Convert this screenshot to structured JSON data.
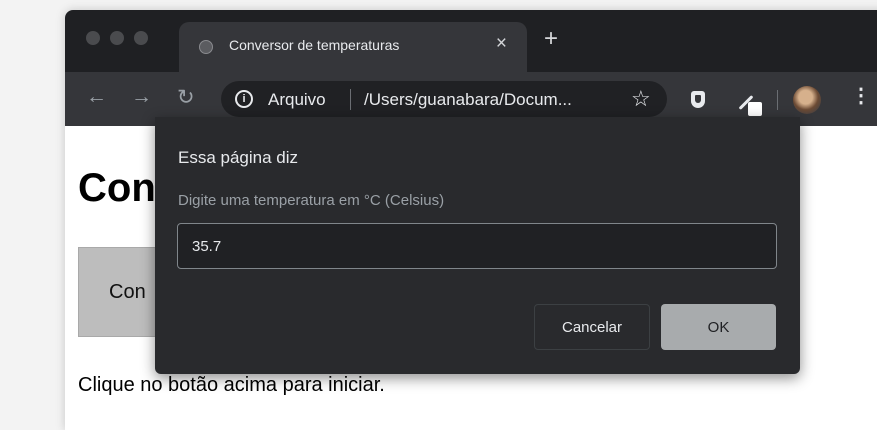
{
  "browser": {
    "tab": {
      "title": "Conversor de temperaturas",
      "close": "×"
    },
    "new_tab": "+",
    "nav": {
      "back": "←",
      "forward": "→",
      "reload": "↻"
    },
    "omnibox": {
      "info": "i",
      "scheme": "Arquivo",
      "url": "/Users/guanabara/Docum..."
    },
    "star": "☆",
    "menu": "⋮",
    "colors": {
      "frame": "#1f2023",
      "toolbar": "#35363a",
      "omnibox": "#202124"
    }
  },
  "page": {
    "title": "Con",
    "button_label": "Con",
    "text": "Clique no botão acima para iniciar."
  },
  "dialog": {
    "title": "Essa página diz",
    "message": "Digite uma temperatura em °C (Celsius)",
    "input_value": "35.7",
    "cancel_label": "Cancelar",
    "ok_label": "OK",
    "colors": {
      "background": "#292a2d",
      "ok_button": "#a8abad"
    }
  }
}
